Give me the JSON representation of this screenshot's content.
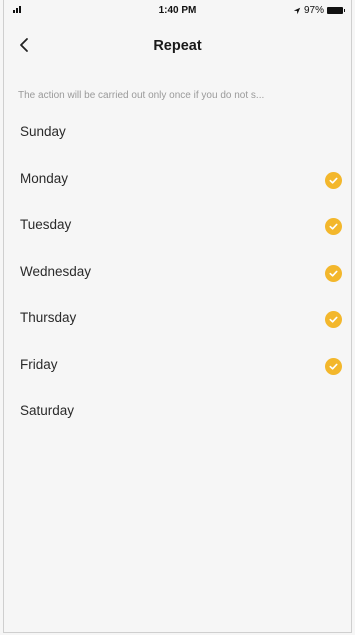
{
  "status_bar": {
    "time": "1:40 PM",
    "battery_text": "97%",
    "location_icon": "location-arrow-icon"
  },
  "nav": {
    "title": "Repeat",
    "back_icon": "chevron-left-icon"
  },
  "hint": "The action will be carried out only once if you do not s...",
  "days": [
    {
      "label": "Sunday",
      "checked": false
    },
    {
      "label": "Monday",
      "checked": true
    },
    {
      "label": "Tuesday",
      "checked": true
    },
    {
      "label": "Wednesday",
      "checked": true
    },
    {
      "label": "Thursday",
      "checked": true
    },
    {
      "label": "Friday",
      "checked": true
    },
    {
      "label": "Saturday",
      "checked": false
    }
  ],
  "colors": {
    "accent": "#f3b72c",
    "background": "#f6f6f6"
  }
}
